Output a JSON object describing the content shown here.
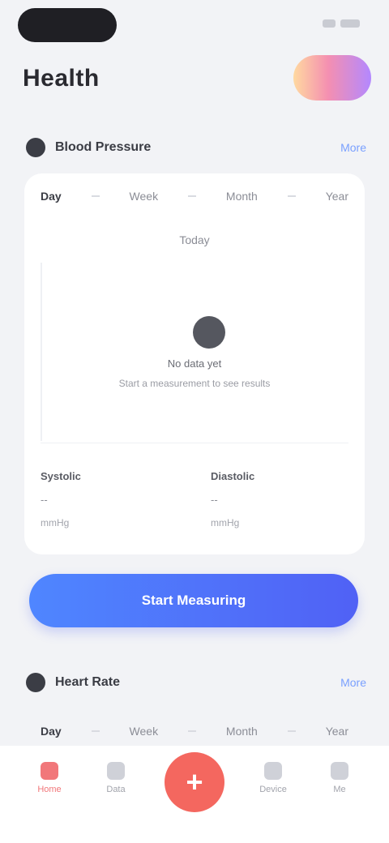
{
  "header": {
    "title": "Health"
  },
  "section1": {
    "title": "Blood Pressure",
    "link": "More"
  },
  "card": {
    "tabs": [
      "Day",
      "Week",
      "Month",
      "Year"
    ],
    "date_label": "Today",
    "empty_title": "No data yet",
    "empty_subtitle": "Start a measurement to see results",
    "stats": [
      {
        "label": "Systolic",
        "value": "--",
        "sub": "mmHg"
      },
      {
        "label": "Diastolic",
        "value": "--",
        "sub": "mmHg"
      }
    ]
  },
  "cta": {
    "label": "Start Measuring"
  },
  "section2": {
    "title": "Heart Rate",
    "link": "More",
    "tabs": [
      "Day",
      "Week",
      "Month",
      "Year"
    ]
  },
  "tab_bar": {
    "items": [
      {
        "label": "Home",
        "icon": "home-icon"
      },
      {
        "label": "Data",
        "icon": "chart-icon"
      },
      {
        "label": "",
        "icon": "plus-icon"
      },
      {
        "label": "Device",
        "icon": "watch-icon"
      },
      {
        "label": "Me",
        "icon": "user-icon"
      }
    ],
    "center_glyph": "+"
  },
  "colors": {
    "accent": "#4f86ff",
    "accent_end": "#5061f5",
    "active_red": "#f4675f"
  }
}
